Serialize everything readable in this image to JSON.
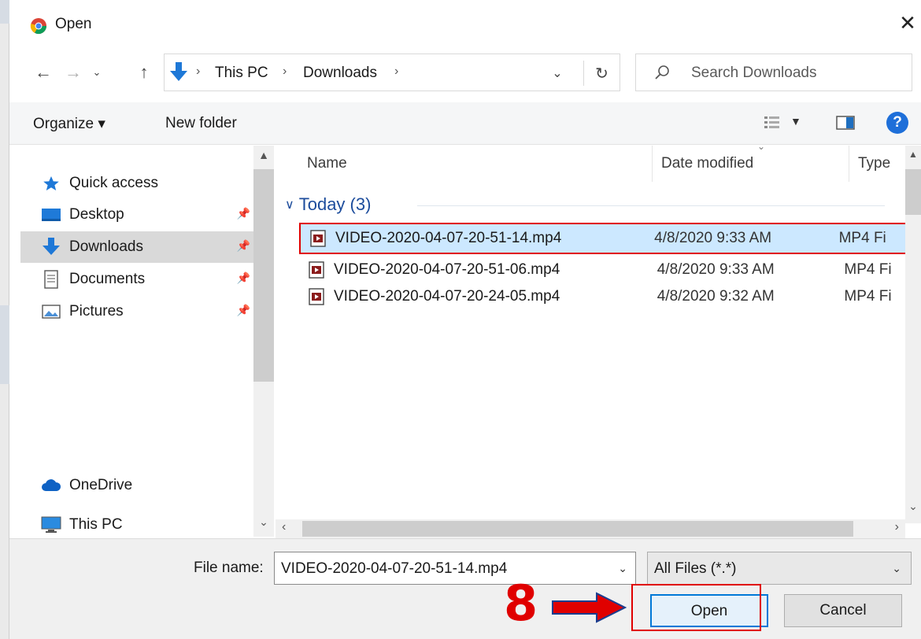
{
  "window": {
    "title": "Open",
    "close_glyph": "✕"
  },
  "address": {
    "path": [
      "This PC",
      "Downloads"
    ],
    "search_placeholder": "Search Downloads"
  },
  "toolbar": {
    "organize_label": "Organize ▾",
    "new_folder_label": "New folder",
    "help_glyph": "?"
  },
  "nav": {
    "items": [
      {
        "label": "Quick access",
        "icon": "star-icon"
      },
      {
        "label": "Desktop",
        "icon": "desktop-folder-icon"
      },
      {
        "label": "Downloads",
        "icon": "download-arrow-icon"
      },
      {
        "label": "Documents",
        "icon": "documents-icon"
      },
      {
        "label": "Pictures",
        "icon": "pictures-icon"
      },
      {
        "label": "OneDrive",
        "icon": "cloud-icon"
      },
      {
        "label": "This PC",
        "icon": "monitor-icon"
      }
    ]
  },
  "files": {
    "columns": [
      "Name",
      "Date modified",
      "Type"
    ],
    "group": "Today (3)",
    "rows": [
      {
        "name": "VIDEO-2020-04-07-20-51-14.mp4",
        "date": "4/8/2020 9:33 AM",
        "type": "MP4 Fi"
      },
      {
        "name": "VIDEO-2020-04-07-20-51-06.mp4",
        "date": "4/8/2020 9:33 AM",
        "type": "MP4 Fi"
      },
      {
        "name": "VIDEO-2020-04-07-20-24-05.mp4",
        "date": "4/8/2020 9:32 AM",
        "type": "MP4 Fi"
      }
    ]
  },
  "bottom": {
    "file_name_label": "File name:",
    "file_name_value": "VIDEO-2020-04-07-20-51-14.mp4",
    "file_type_value": "All Files (*.*)",
    "open_label": "Open",
    "cancel_label": "Cancel"
  },
  "annotation": {
    "step_number": "8",
    "highlight_color": "#e00000"
  }
}
